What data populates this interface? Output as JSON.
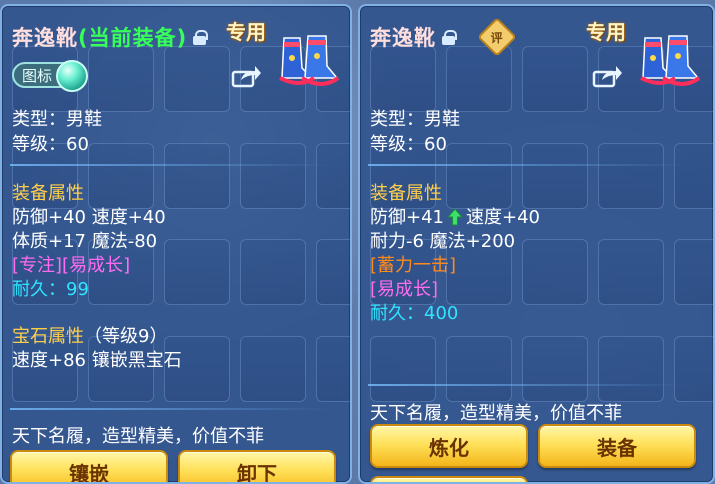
{
  "left": {
    "name": "奔逸靴",
    "equipped_label": "(当前装备)",
    "exclusive": "专用",
    "tag_label": "图标",
    "type_line": "类型：男鞋",
    "level_line": "等级：60",
    "attr_title": "装备属性",
    "attr_line1": "防御+40 速度+40",
    "attr_line2": "体质+17 魔法-80",
    "special": "[专注][易成长]",
    "durability_label": "耐久：",
    "durability_value": "99",
    "gem_title": "宝石属性",
    "gem_level": "（等级9）",
    "gem_line": "速度+86 镶嵌黑宝石",
    "description": "天下名履，造型精美，价值不菲",
    "buttons": {
      "inlay": "镶嵌",
      "unequip": "卸下"
    }
  },
  "right": {
    "name": "奔逸靴",
    "eval_badge": "评",
    "exclusive": "专用",
    "type_line": "类型：男鞋",
    "level_line": "等级：60",
    "attr_title": "装备属性",
    "attr_line1_a": "防御+41",
    "attr_line1_b": "速度+40",
    "attr_line2": "耐力-6 魔法+200",
    "special1": "[蓄力一击]",
    "special2": "[易成长]",
    "durability_label": "耐久：",
    "durability_value": "400",
    "description": "天下名履，造型精美，价值不菲",
    "buttons": {
      "refine": "炼化",
      "equip": "装备"
    }
  },
  "colors": {
    "equipped": "#37ff5a",
    "section_title": "#ffcf4a",
    "special_magenta": "#ff6cf0",
    "special_orange": "#ff8a1c",
    "durability": "#2fe4ff",
    "button_gold": "#ffe15a"
  },
  "icons": [
    "lock-icon",
    "boots-icon",
    "share-icon",
    "tag-orb-icon",
    "eval-badge-icon",
    "arrow-up-icon"
  ]
}
